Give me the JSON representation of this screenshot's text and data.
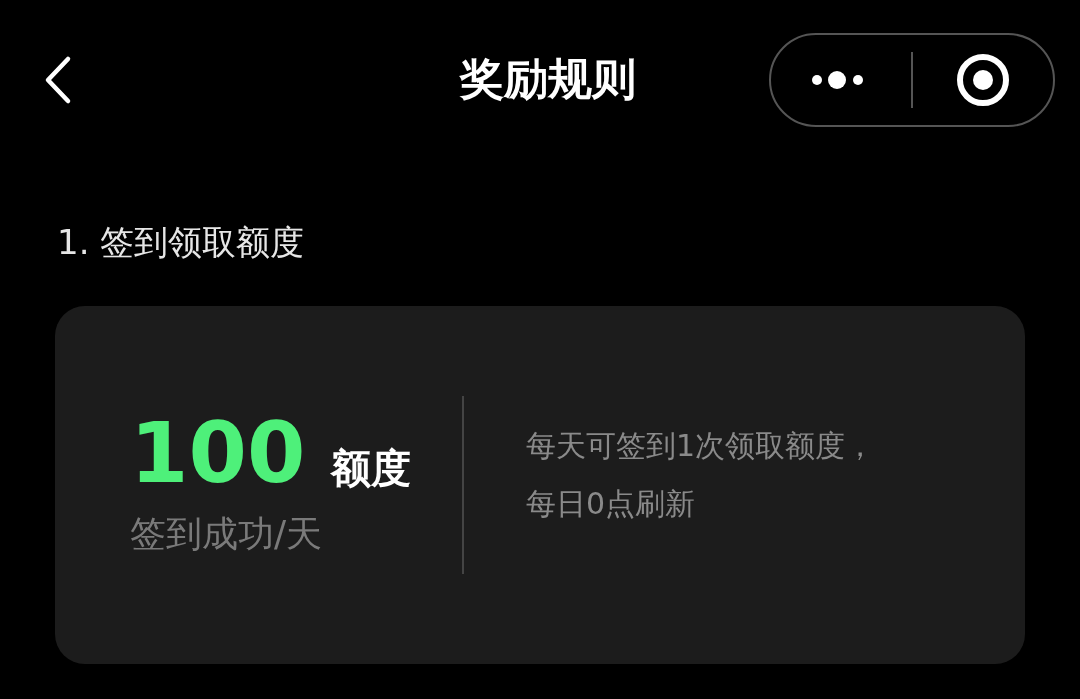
{
  "header": {
    "title": "奖励规则"
  },
  "section": {
    "title": "1. 签到领取额度"
  },
  "card": {
    "amount": "100",
    "unit": "额度",
    "caption": "签到成功/天",
    "description": "每天可签到1次领取额度，每日0点刷新"
  }
}
